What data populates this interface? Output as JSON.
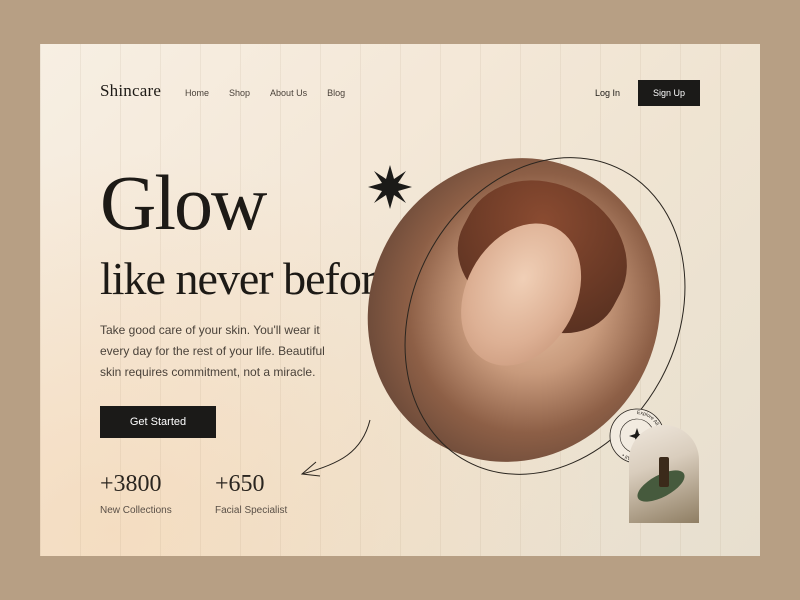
{
  "brand": {
    "logo_text": "Shincare"
  },
  "nav": {
    "items": [
      {
        "label": "Home"
      },
      {
        "label": "Shop"
      },
      {
        "label": "About Us"
      },
      {
        "label": "Blog"
      }
    ],
    "login_label": "Log In",
    "signup_label": "Sign Up"
  },
  "hero": {
    "headline": "Glow",
    "subheadline": "like never before",
    "description": "Take good care of your skin. You'll wear it every day for the rest of your life. Beautiful skin requires commitment, not a miracle.",
    "cta_label": "Get Started"
  },
  "stats": [
    {
      "value": "+3800",
      "label": "New Collections"
    },
    {
      "value": "+650",
      "label": "Facial Specialist"
    }
  ],
  "badge": {
    "ring_text": "Explore All • Explore All • Explore All •"
  },
  "icons": {
    "star_burst": "starburst-icon",
    "sparkle": "sparkle-icon"
  },
  "colors": {
    "primary_dark": "#1b1a18",
    "background_outer": "#b79f84",
    "card_background": "#f4e8d8"
  }
}
